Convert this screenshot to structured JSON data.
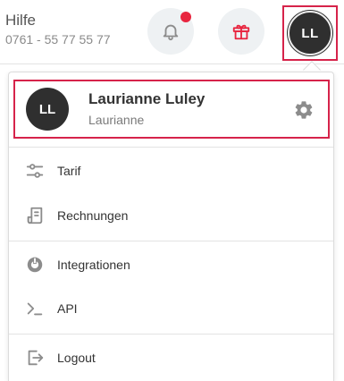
{
  "header": {
    "help_title": "Hilfe",
    "help_phone": "0761 - 55 77 55 77",
    "bell_icon": "bell-icon",
    "gift_icon": "gift-icon",
    "avatar_initials": "LL"
  },
  "profile": {
    "initials": "LL",
    "name": "Laurianne Luley",
    "username": "Laurianne",
    "settings_icon": "gear-icon"
  },
  "menu": {
    "items": [
      {
        "label": "Tarif",
        "icon": "sliders-icon"
      },
      {
        "label": "Rechnungen",
        "icon": "invoice-icon"
      },
      {
        "label": "Integrationen",
        "icon": "integrations-icon"
      },
      {
        "label": "API",
        "icon": "terminal-icon"
      },
      {
        "label": "Logout",
        "icon": "logout-icon"
      }
    ]
  },
  "colors": {
    "highlight_border": "#d6234a",
    "notification_dot": "#e8253f",
    "gift": "#e8253f",
    "avatar_bg": "#2f2f2f",
    "icon_gray": "#8c8c8c",
    "button_bg": "#eef1f3"
  }
}
